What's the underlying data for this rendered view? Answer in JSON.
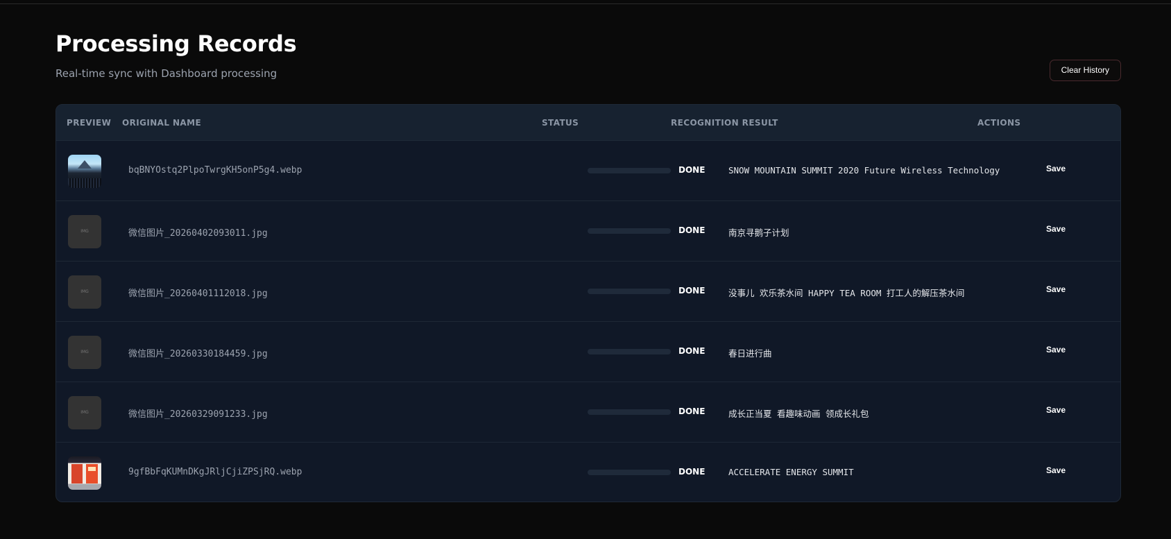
{
  "header": {
    "title": "Processing Records",
    "subtitle": "Real-time sync with Dashboard processing",
    "clear_label": "Clear History"
  },
  "table": {
    "columns": {
      "preview": "PREVIEW",
      "name": "ORIGINAL NAME",
      "status": "STATUS",
      "result": "RECOGNITION RESULT",
      "actions": "ACTIONS"
    },
    "placeholder_label": "IMG",
    "save_label": "Save",
    "rows": [
      {
        "preview": "image",
        "name": "bqBNYOstq2PlpoTwrgKH5onP5g4.webp",
        "status": "DONE",
        "result": "SNOW MOUNTAIN SUMMIT 2020 Future Wireless Technology"
      },
      {
        "preview": "placeholder",
        "name": "微信图片_20260402093011.jpg",
        "status": "DONE",
        "result": "南京寻鹅子计划"
      },
      {
        "preview": "placeholder",
        "name": "微信图片_20260401112018.jpg",
        "status": "DONE",
        "result": "没事儿 欢乐茶水间 HAPPY TEA ROOM 打工人的解压茶水间"
      },
      {
        "preview": "placeholder",
        "name": "微信图片_20260330184459.jpg",
        "status": "DONE",
        "result": "春日进行曲"
      },
      {
        "preview": "placeholder",
        "name": "微信图片_20260329091233.jpg",
        "status": "DONE",
        "result": "成长正当夏  看趣味动画 领成长礼包"
      },
      {
        "preview": "image",
        "name": "9gfBbFqKUMnDKgJRljCjiZPSjRQ.webp",
        "status": "DONE",
        "result": "ACCELERATE ENERGY SUMMIT"
      }
    ]
  },
  "colors": {
    "background": "#0a0a0a",
    "table_bg": "#101827",
    "header_bg": "#172230",
    "muted_text": "#9ca3af"
  }
}
